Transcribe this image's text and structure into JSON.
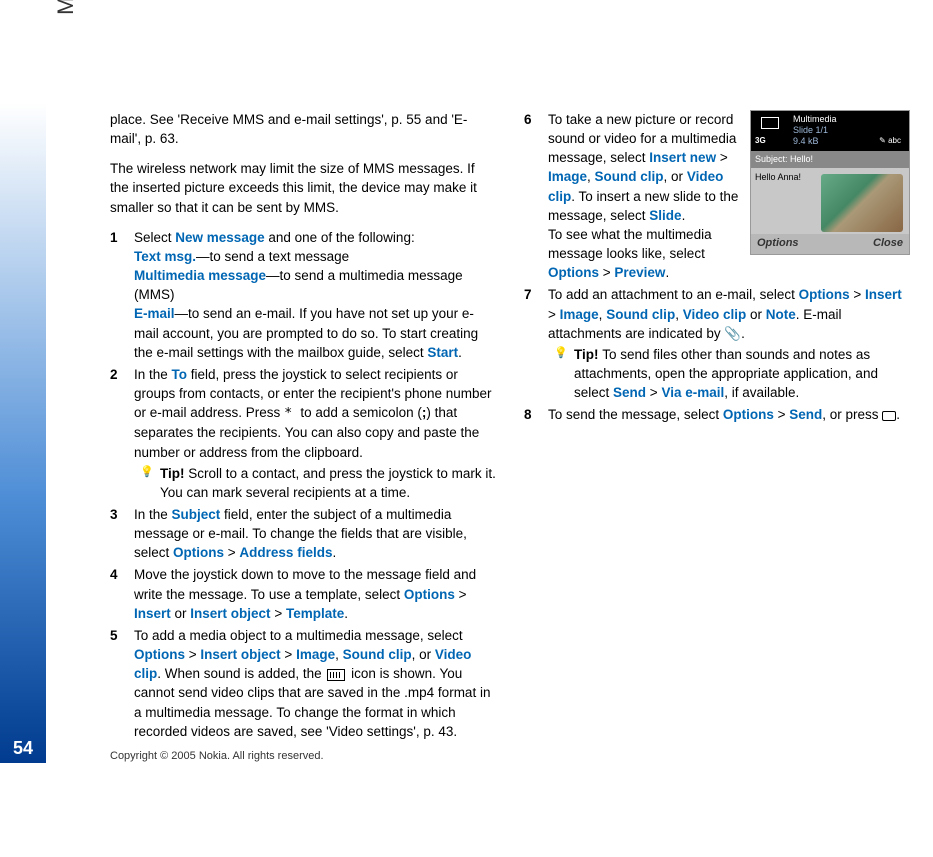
{
  "page": {
    "number": "54",
    "section": "Messaging",
    "copyright": "Copyright © 2005 Nokia. All rights reserved."
  },
  "intro": {
    "p1": "place. See 'Receive MMS and e-mail settings', p. 55 and 'E-mail', p. 63.",
    "p2": "The wireless network may limit the size of MMS messages. If the inserted picture exceeds this limit, the device may make it smaller so that it can be sent by MMS."
  },
  "steps": {
    "s1": {
      "a": "Select ",
      "b": "New message",
      "c": " and one of the following:",
      "t1a": "Text msg.",
      "t1b": "—to send a text message",
      "t2a": "Multimedia message",
      "t2b": "—to send a multimedia message (MMS)",
      "t3a": "E-mail",
      "t3b": "—to send an e-mail. If you have not set up your e-mail account, you are prompted to do so. To start creating the e-mail settings with the mailbox guide, select ",
      "t3c": "Start",
      "t3d": "."
    },
    "s2": {
      "a": "In the ",
      "b": "To",
      "c": " field, press the joystick to select recipients or groups from contacts, or enter the recipient's phone number or e-mail address. Press ",
      "star": " * ",
      "d": " to add a semicolon (",
      "semi": ";",
      "e": ") that separates the recipients. You can also copy and paste the number or address from the clipboard.",
      "tip_label": "Tip! ",
      "tip": "Scroll to a contact, and press the joystick to mark it. You can mark several recipients at a time."
    },
    "s3": {
      "a": "In the ",
      "b": "Subject",
      "c": " field, enter the subject of a multimedia message or e-mail. To change the fields that are visible, select ",
      "d": "Options",
      "e": " > ",
      "f": "Address fields",
      "g": "."
    },
    "s4": {
      "a": "Move the joystick down to move to the message field and write the message. To use a template, select ",
      "b": "Options",
      "c": " > ",
      "d": "Insert",
      "e": " or ",
      "f": "Insert object",
      "g": " > ",
      "h": "Template",
      "i": "."
    },
    "s5": {
      "a": "To add a media object to a multimedia message, select ",
      "b": "Options",
      "c": " > ",
      "d": "Insert object",
      "e": " > ",
      "f": "Image",
      "g": ", ",
      "h": "Sound clip",
      "i": ", or ",
      "j": "Video clip",
      "k": ". When sound is added, the ",
      "l": " icon is shown.",
      "m": "You cannot send video clips that are saved in the .mp4 format in a multimedia message. To change the format in which recorded videos are saved, see 'Video settings', p. 43."
    },
    "s6": {
      "a": "To take a  new picture or record sound or video for a multimedia message, select ",
      "b": "Insert new",
      "c": " > ",
      "d": "Image",
      "e": ", ",
      "f": "Sound clip",
      "g": ", or ",
      "h": "Video clip",
      "i": ". To insert a new slide to the message, select ",
      "j": "Slide",
      "k": ".",
      "l": "To see what the multimedia message looks like, select ",
      "m": "Options",
      "n": " > ",
      "o": "Preview",
      "p": "."
    },
    "s7": {
      "a": "To add an attachment to an e-mail, select ",
      "b": "Options",
      "c": " > ",
      "d": "Insert",
      "e": " > ",
      "f": "Image",
      "g": ", ",
      "h": "Sound clip",
      "i": ", ",
      "j": "Video clip",
      "k": " or ",
      "l": "Note",
      "m": ". E-mail attachments are indicated by ",
      "n": ".",
      "tip_label": "Tip! ",
      "tip_a": "To send files other than sounds and notes as attachments, open the appropriate application, and select ",
      "tip_b": "Send",
      "tip_c": " > ",
      "tip_d": "Via e-mail",
      "tip_e": ", if available."
    },
    "s8": {
      "a": "To send the message, select ",
      "b": "Options",
      "c": " > ",
      "d": "Send",
      "e": ", or press ",
      "f": "."
    }
  },
  "phone": {
    "title": "Multimedia",
    "slide": "Slide 1/1",
    "size": "9.4 kB",
    "net": "3G",
    "mode": " abc",
    "subject_label": "Subject: ",
    "subject_value": "Hello!",
    "body": "Hello Anna!",
    "left_key": "Options",
    "right_key": "Close"
  }
}
